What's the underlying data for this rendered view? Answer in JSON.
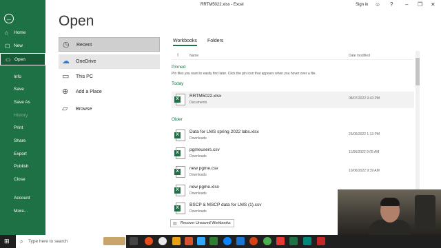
{
  "window": {
    "title": "RRTM5022.xlsx  -  Excel",
    "sign_in": "Sign in"
  },
  "nav": {
    "back": "←",
    "items": [
      {
        "label": "Home",
        "icon": "home-icon"
      },
      {
        "label": "New",
        "icon": "new-file-icon"
      },
      {
        "label": "Open",
        "icon": "folder-open-icon"
      },
      {
        "label": "Info"
      },
      {
        "label": "Save"
      },
      {
        "label": "Save As"
      },
      {
        "label": "History"
      },
      {
        "label": "Print"
      },
      {
        "label": "Share"
      },
      {
        "label": "Export"
      },
      {
        "label": "Publish"
      },
      {
        "label": "Close"
      },
      {
        "label": "Account"
      },
      {
        "label": "More..."
      }
    ]
  },
  "open": {
    "heading": "Open",
    "locations": [
      {
        "label": "Recent",
        "icon": "clock-icon"
      },
      {
        "label": "OneDrive",
        "icon": "cloud-icon"
      },
      {
        "label": "This PC",
        "icon": "computer-icon"
      },
      {
        "label": "Add a Place",
        "icon": "globe-icon"
      },
      {
        "label": "Browse",
        "icon": "folder-icon"
      }
    ]
  },
  "tabs": {
    "workbooks": "Workbooks",
    "folders": "Folders"
  },
  "columns": {
    "name": "Name",
    "date": "Date modified"
  },
  "pinned": {
    "label": "Pinned",
    "note": "Pin files you want to easily find later. Click the pin icon that appears when you hover over a file."
  },
  "today": {
    "label": "Today",
    "files": [
      {
        "name": "RRTM5022.xlsx",
        "location": "Documents",
        "date": "08/07/2022 9:43 PM"
      }
    ]
  },
  "older": {
    "label": "Older",
    "files": [
      {
        "name": "Data for LMS  spring 2022 labs.xlsx",
        "location": "Downloads",
        "date": "25/06/2022 1:13 PM"
      },
      {
        "name": "pgmeusers.csv",
        "location": "Downloads",
        "date": "11/06/2022 9:05 AM"
      },
      {
        "name": "new pgme.csv",
        "location": "Downloads",
        "date": "10/06/2022 9:39 AM"
      },
      {
        "name": "new pgme.xlsx",
        "location": "Downloads",
        "date": ""
      },
      {
        "name": "BSCP & MSCP data for LMS (1).csv",
        "location": "Downloads",
        "date": ""
      }
    ]
  },
  "recover_button": "Recover Unsaved Workbooks",
  "taskbar": {
    "search_placeholder": "Type here to search"
  },
  "colors": {
    "accent": "#1e7145",
    "taskbar": "#202020"
  }
}
